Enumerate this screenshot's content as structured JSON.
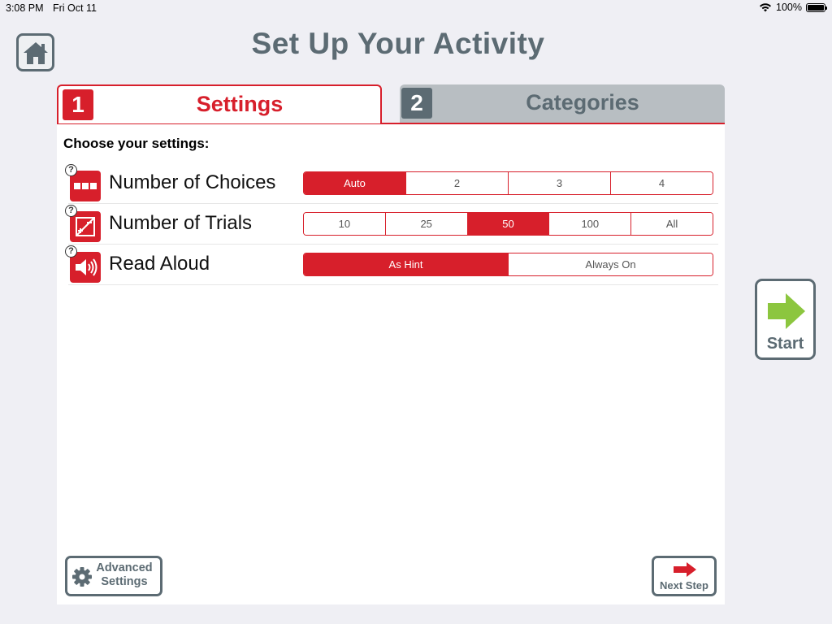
{
  "status_bar": {
    "time": "3:08 PM",
    "date": "Fri Oct 11",
    "battery": "100%"
  },
  "header": {
    "title": "Set Up Your Activity"
  },
  "tabs": [
    {
      "number": "1",
      "label": "Settings",
      "active": true
    },
    {
      "number": "2",
      "label": "Categories",
      "active": false
    }
  ],
  "settings": {
    "heading": "Choose your settings:",
    "rows": [
      {
        "label": "Number of Choices",
        "options": [
          "Auto",
          "2",
          "3",
          "4"
        ],
        "selected": "Auto"
      },
      {
        "label": "Number of Trials",
        "options": [
          "10",
          "25",
          "50",
          "100",
          "All"
        ],
        "selected": "50"
      },
      {
        "label": "Read Aloud",
        "options": [
          "As Hint",
          "Always On"
        ],
        "selected": "As Hint"
      }
    ],
    "help_glyph": "?"
  },
  "buttons": {
    "advanced_line1": "Advanced",
    "advanced_line2": "Settings",
    "next_step": "Next Step",
    "start": "Start"
  },
  "colors": {
    "accent": "#d71f2b",
    "slate": "#5c6b73",
    "start_arrow": "#8cc63f"
  }
}
